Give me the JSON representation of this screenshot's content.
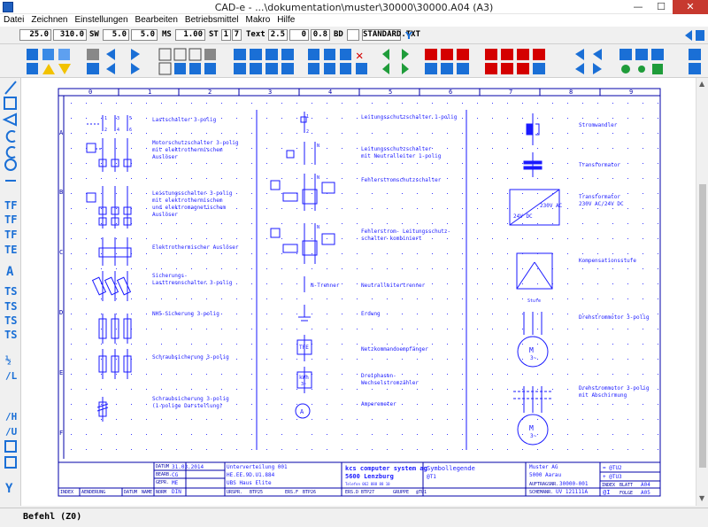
{
  "window": {
    "title": "CAD-e - ...\\dokumentation\\muster\\30000\\30000.A04 (A3)",
    "minimize": "—",
    "maximize": "☐",
    "close": "✕"
  },
  "menu": [
    "Datei",
    "Zeichnen",
    "Einstellungen",
    "Bearbeiten",
    "Betriebsmittel",
    "Makro",
    "Hilfe"
  ],
  "params": {
    "f1": "25.0",
    "f2": "310.0",
    "sw_label": "SW",
    "sw": "5.0",
    "f4": "5.0",
    "ms_label": "MS",
    "ms": "1.00",
    "st_label": "ST",
    "st1": "1",
    "st2": "7",
    "text_label": "Text",
    "t1": "2.5",
    "t2": "0",
    "t3": "0.8",
    "bd_label": "BD",
    "bd": "",
    "font": "STANDARD.TXT"
  },
  "status": {
    "command": "Befehl (Z0)"
  },
  "grid_columns": [
    "0",
    "1",
    "2",
    "3",
    "4",
    "5",
    "6",
    "7",
    "8",
    "9"
  ],
  "grid_rows": [
    "A",
    "B",
    "C",
    "D",
    "E",
    "F"
  ],
  "symbols": {
    "col1": [
      "Lastschalter 3-polig",
      "Motorschutzschalter 3-polig",
      "mit elektrothermischem",
      "Auslöser",
      "Leistungsschalter 3-polig",
      "mit elektrothermischem",
      "und elektromagnetischem",
      "Auslöser",
      "Elektrothermischer Auslöser",
      "Sicherungs-",
      "Lasttrennschalter 3-polig",
      "NH5-Sicherung 3-polig",
      "Schraubsicherung 3-polig",
      "Schraubsicherung 3-polig",
      "(1-polige Darstellung)"
    ],
    "col2": [
      "Leitungsschutzschalter 1-polig",
      "Leitungsschutzschalter",
      "mit Neutralleiter 1-polig",
      "Fehlerstromschutzschalter",
      "Fehlerstrom- Leitungsschutz-",
      "schalter kombiniert",
      "Neutralleitertrenner",
      "Erdung",
      "Netzkommandoempfänger",
      "Dreiphasen-",
      "Wechselstromzähler",
      "Amperemeter"
    ],
    "col2_inline": {
      "ntrenner": "N-Trenner",
      "tfe": "TFE",
      "kwh": "kWh",
      "kwh_sub": "3~",
      "ammeter": "A"
    },
    "col3": [
      "Stromwandler",
      "Transformator",
      "Transformator",
      "230V AC/24V DC",
      "Kompensationsstufe",
      "Drehstrommotor 3-polig",
      "Drehstrommotor 3-polig",
      "mit Abschirmung"
    ],
    "col3_inline": {
      "ac": "230V AC",
      "dc": "24V DC",
      "stufe": "Stufe",
      "motor": "M",
      "motor_sub": "3~"
    },
    "terminals": {
      "l1": "1",
      "l3": "3",
      "l5": "5",
      "t2": "2",
      "t4": "4",
      "t6": "6",
      "n": "N"
    }
  },
  "titleblock": {
    "datum_label": "DATUM",
    "datum": "31.03.2014",
    "bearb_label": "BEARB.",
    "bearb": "CG",
    "gepr_label": "GEPR.",
    "gepr": "ME",
    "norm_label": "NORM",
    "norm": "DIN",
    "index": "INDEX",
    "aenderung": "AENDERUNG",
    "datum2": "DATUM",
    "name": "NAME",
    "project1": "Unterverteilung 001",
    "project2": "HE.EE.9D.U1.884",
    "project3": "UBS Haus Elite",
    "urspr": "URSPR.",
    "urspr_val": "BTP25",
    "ers_f": "ERS.F",
    "ers_f_val": "BTP26",
    "company1": "kcs computer system ag",
    "company2": "5600 Lenzburg",
    "company3": "Telefon 062 888 88 10",
    "ers_d": "ERS.D",
    "ers_d_val": "BTP27",
    "sheet_title": "Symbollegende",
    "sheet_sub": "@T1",
    "gruppe": "GRUPPE",
    "gruppe_val": "@TU1",
    "customer1": "Muster AG",
    "customer2": "5000 Aarau",
    "auftrag_label": "AUFTRAGSNR.",
    "auftrag": "30000-001",
    "schema_label": "SCHEMANR.",
    "schema": "UV 121111A",
    "r1": "= @TU2",
    "r2": "+ @TU3",
    "index_label": "INDEX",
    "blatt_label": "BLATT",
    "blatt": "A04",
    "et": "@I",
    "folge_label": "FOLGE",
    "folge": "A05"
  },
  "colors": {
    "drawing": "#1a1aff",
    "frame": "#0000aa",
    "grid_dot": "#3c3cff"
  }
}
